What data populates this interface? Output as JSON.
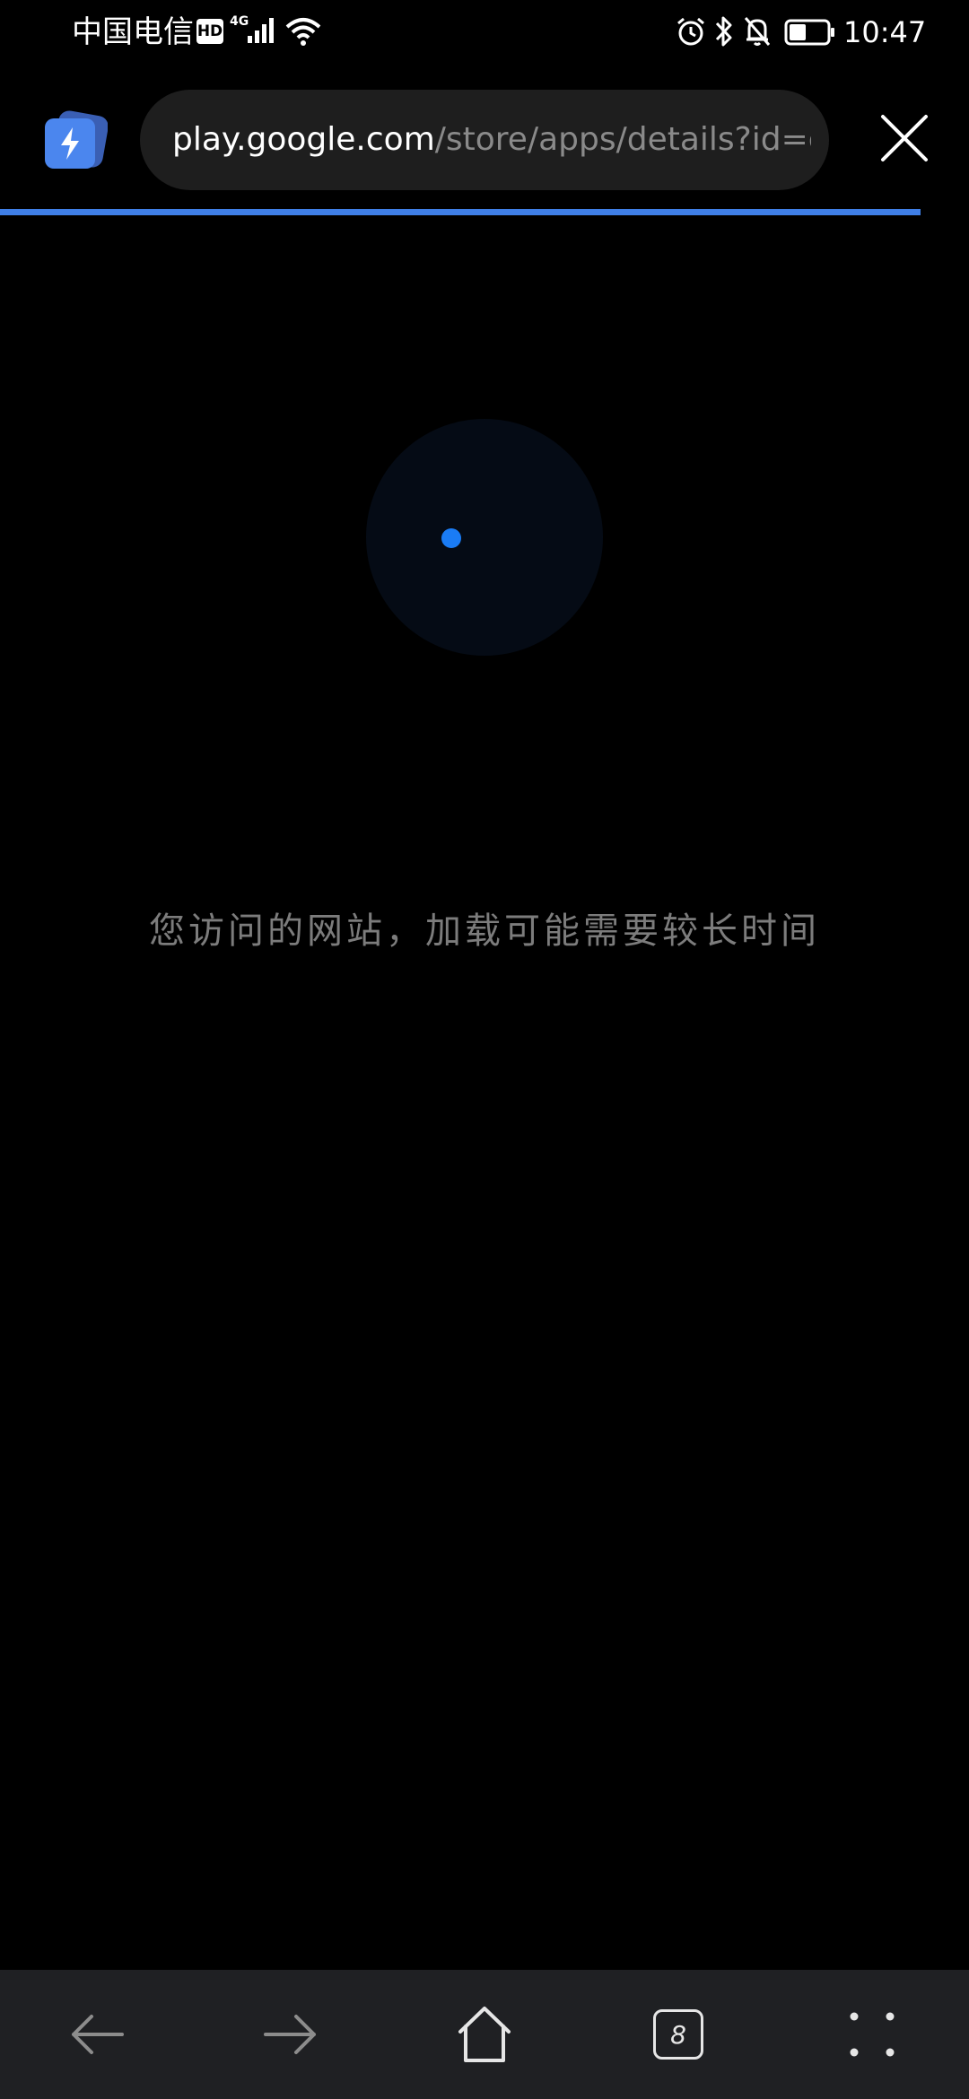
{
  "status_bar": {
    "carrier": "中国电信",
    "hd_badge": "HD",
    "network_type": "4G",
    "time": "10:47",
    "battery_level": 0.45,
    "icons": [
      "signal-icon",
      "wifi-icon",
      "alarm-icon",
      "bluetooth-icon",
      "mute-icon",
      "battery-icon"
    ]
  },
  "top_bar": {
    "app_icon": "lightning-icon",
    "url_domain": "play.google.com",
    "url_path": "/store/apps/details?id=com",
    "close_icon": "close-icon",
    "load_progress": 0.95
  },
  "loading": {
    "message": "您访问的网站，加载可能需要较长时间"
  },
  "bottom_nav": {
    "items": [
      {
        "icon": "back-arrow-icon",
        "enabled": true
      },
      {
        "icon": "forward-arrow-icon",
        "enabled": true
      },
      {
        "icon": "home-icon",
        "enabled": true
      },
      {
        "icon": "tabs-icon",
        "tab_count": "8"
      },
      {
        "icon": "menu-dots-icon",
        "enabled": true
      }
    ]
  },
  "colors": {
    "accent": "#1a7cf5",
    "progress": "#3f7fe7",
    "nav_background": "#1f2023",
    "url_bar_background": "#1e1e1e"
  }
}
